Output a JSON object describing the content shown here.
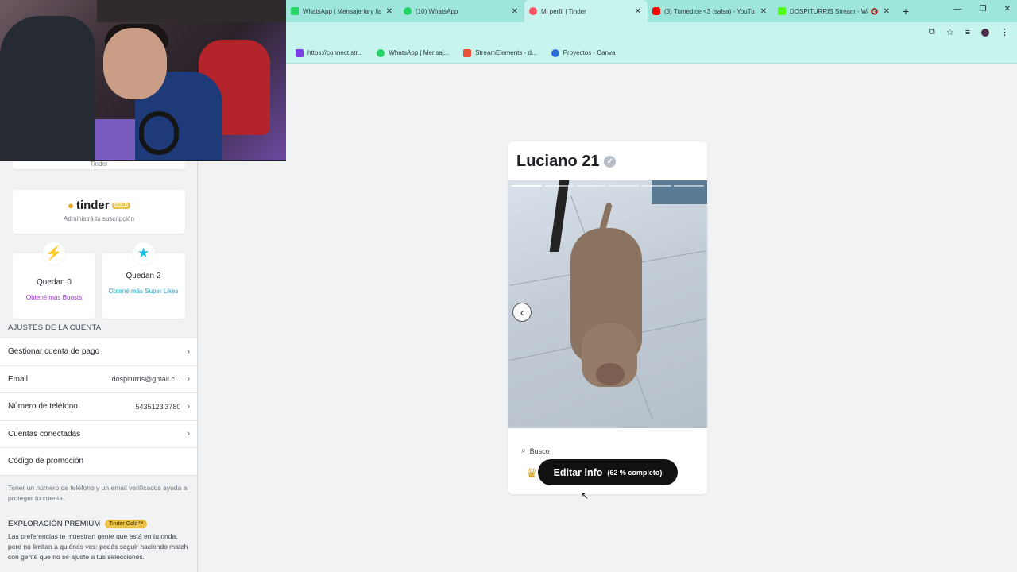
{
  "browser": {
    "tabs": [
      {
        "title": "WhatsApp | Mensajería y llama",
        "favicon_color": "#25d366",
        "active": false
      },
      {
        "title": "(10) WhatsApp",
        "favicon_color": "#25d366",
        "active": false
      },
      {
        "title": "Mi perfil | Tinder",
        "favicon_color": "#fd5564",
        "active": true
      },
      {
        "title": "(3) Tumedice <3 (salsa) - YouTu",
        "favicon_color": "#ff0000",
        "active": false
      },
      {
        "title": "DOSPITURRIS Stream - Wat",
        "favicon_color": "#53fc18",
        "active": false
      }
    ],
    "bookmarks": [
      {
        "label": "https://connect.str...",
        "favicon_color": "#7b3fe4"
      },
      {
        "label": "WhatsApp | Mensaj...",
        "favicon_color": "#25d366"
      },
      {
        "label": "StreamElements - d...",
        "favicon_color": "#e8503a"
      },
      {
        "label": "Proyectos - Canva",
        "favicon_color": "#2b6fd6"
      }
    ]
  },
  "sidebar": {
    "top_card_text": "Tinder",
    "gold": {
      "logo_text": "tinder",
      "badge": "GOLD",
      "subtitle": "Administrá tu suscripción"
    },
    "boosts": {
      "remaining": "Quedan 0",
      "link": "Obtené más Boosts"
    },
    "superlikes": {
      "remaining": "Quedan 2",
      "link": "Obtené más Super Likes"
    },
    "account_title": "AJUSTES DE LA CUENTA",
    "rows": [
      {
        "label": "Gestionar cuenta de pago",
        "value": ""
      },
      {
        "label": "Email",
        "value": "dospiturris@gmail.c..."
      },
      {
        "label": "Número de teléfono",
        "value": "5435123'3780"
      },
      {
        "label": "Cuentas conectadas",
        "value": ""
      },
      {
        "label": "Código de promoción",
        "value": ""
      }
    ],
    "note": "Tener un número de teléfono y un email verificados ayuda a proteger tu cuenta.",
    "premium_title": "EXPLORACIÓN PREMIUM",
    "premium_badge": "Tinder Gold™",
    "premium_desc": "Las preferencias te muestran gente que está en tu onda, pero no limitan a quiénes ves: podés seguir haciendo match con gente que no se ajuste a tus selecciones."
  },
  "profile": {
    "name_age": "Luciano 21",
    "looking_for_label": "Busco",
    "edit_button": "Editar info",
    "completion": "(62 % completo)",
    "photo_count": 6,
    "current_photo": 1
  },
  "colors": {
    "accent_boost": "#a12bd6",
    "accent_superlike": "#1dbde3",
    "gold": "#e9c14b",
    "browser_chrome": "#c8f4ee"
  }
}
